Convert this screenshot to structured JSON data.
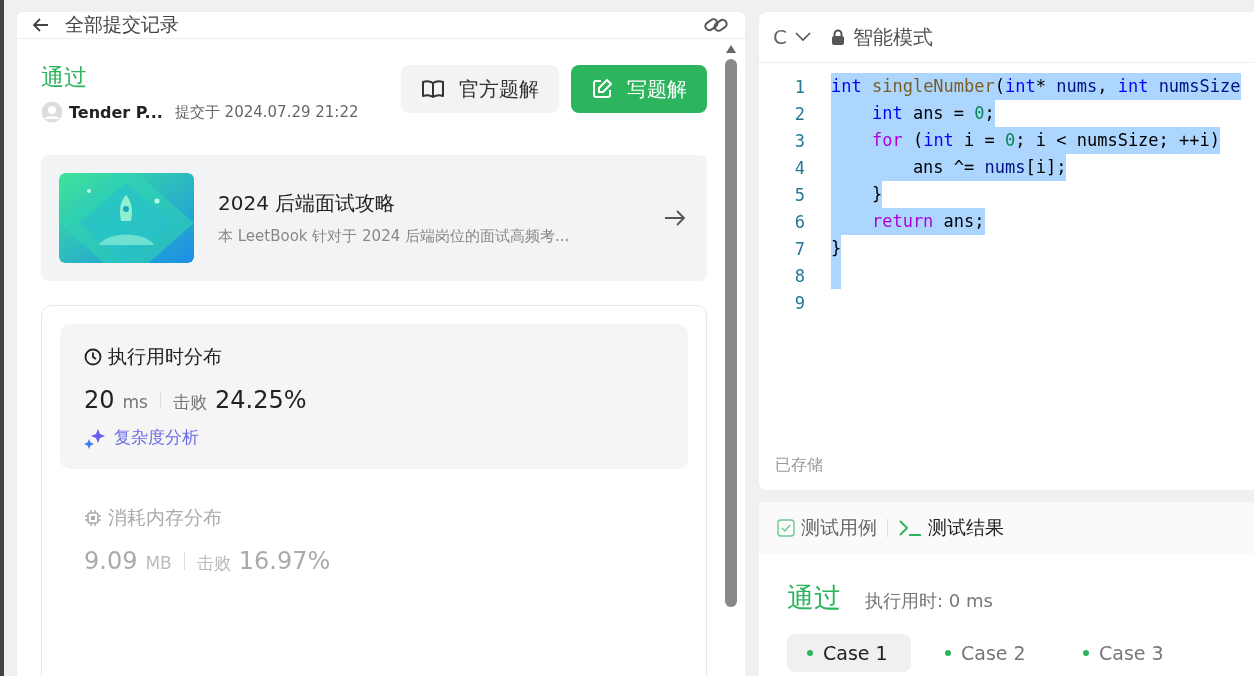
{
  "header": {
    "back_label": "全部提交记录"
  },
  "result": {
    "status": "通过",
    "author": "Tender P...",
    "submitted": "提交于 2024.07.29 21:22"
  },
  "buttons": [
    {
      "label": "官方题解",
      "kind": "secondary"
    },
    {
      "label": "写题解",
      "kind": "primary"
    }
  ],
  "promo": {
    "title": "2024 后端面试攻略",
    "description": "本 LeetBook 针对于 2024 后端岗位的面试高频考..."
  },
  "stats": [
    {
      "kind": "time",
      "title": "执行用时分布",
      "value": "20",
      "unit": "ms",
      "beat_label": "击败",
      "beat": "24.25%",
      "link": "复杂度分析",
      "selected": true
    },
    {
      "kind": "memory",
      "title": "消耗内存分布",
      "value": "9.09",
      "unit": "MB",
      "beat_label": "击败",
      "beat": "16.97%",
      "selected": false
    }
  ],
  "editor": {
    "language": "C",
    "mode": "智能模式",
    "status": "已存储",
    "lines": [
      {
        "number": "1",
        "selected": true,
        "tokens": [
          {
            "text": "int",
            "kind": "type"
          },
          {
            "text": " singleNumber",
            "kind": "fn"
          },
          {
            "text": "(",
            "kind": "plain"
          },
          {
            "text": "int",
            "kind": "type"
          },
          {
            "text": "* ",
            "kind": "plain"
          },
          {
            "text": "nums",
            "kind": "var"
          },
          {
            "text": ", ",
            "kind": "plain"
          },
          {
            "text": "int",
            "kind": "type"
          },
          {
            "text": " numsSize",
            "kind": "var"
          }
        ]
      },
      {
        "number": "2",
        "selected": true,
        "tokens": [
          {
            "text": "    int",
            "kind": "type"
          },
          {
            "text": " ans = ",
            "kind": "plain"
          },
          {
            "text": "0",
            "kind": "num"
          },
          {
            "text": ";",
            "kind": "plain"
          }
        ]
      },
      {
        "number": "3",
        "selected": true,
        "tokens": [
          {
            "text": "    for",
            "kind": "ctrl"
          },
          {
            "text": " (",
            "kind": "plain"
          },
          {
            "text": "int",
            "kind": "type"
          },
          {
            "text": " i = ",
            "kind": "plain"
          },
          {
            "text": "0",
            "kind": "num"
          },
          {
            "text": "; i < numsSize; ++i)",
            "kind": "plain"
          }
        ]
      },
      {
        "number": "4",
        "selected": true,
        "tokens": [
          {
            "text": "        ans ^= ",
            "kind": "plain"
          },
          {
            "text": "nums",
            "kind": "var"
          },
          {
            "text": "[i];",
            "kind": "plain"
          }
        ]
      },
      {
        "number": "5",
        "selected": true,
        "tokens": [
          {
            "text": "    }",
            "kind": "plain"
          }
        ]
      },
      {
        "number": "6",
        "selected": true,
        "tokens": [
          {
            "text": "    return",
            "kind": "ctrl"
          },
          {
            "text": " ans;",
            "kind": "plain"
          }
        ]
      },
      {
        "number": "7",
        "selected": true,
        "tokens": [
          {
            "text": "}",
            "kind": "plain"
          }
        ]
      },
      {
        "number": "8",
        "selected": true
      },
      {
        "number": "9",
        "selected": false
      }
    ]
  },
  "console": {
    "tabs": [
      {
        "kind": "cases",
        "label": "测试用例",
        "selected": false
      },
      {
        "kind": "result",
        "label": "测试结果",
        "selected": true
      }
    ],
    "status": "通过",
    "runtime": "执行用时: 0 ms",
    "cases": [
      {
        "label": "Case 1",
        "selected": true
      },
      {
        "label": "Case 2",
        "selected": false
      },
      {
        "label": "Case 3",
        "selected": false
      }
    ]
  }
}
